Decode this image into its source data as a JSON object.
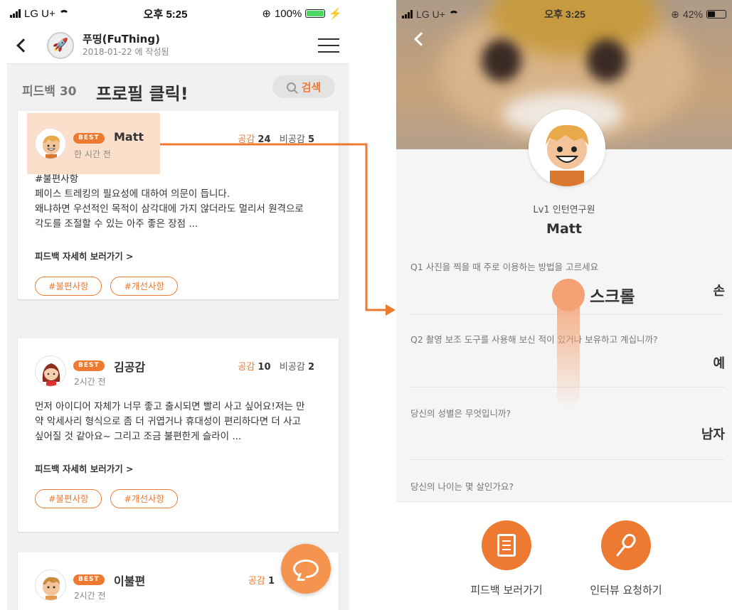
{
  "left_status": {
    "carrier": "LG U+",
    "time": "오후 5:25",
    "battery": "100%"
  },
  "right_status": {
    "carrier": "LG U+",
    "time": "오후 3:25",
    "battery": "42%"
  },
  "appbar": {
    "title": "푸띵(FuThing)",
    "subtitle": "2018-01-22 에 작성됨"
  },
  "list_header": {
    "count_label": "피드백 30",
    "annotation": "프로필 클릭!",
    "search_label": "검색"
  },
  "cards": [
    {
      "badge": "BEST",
      "name": "Matt",
      "time": "한 시간 전",
      "agree_label": "공감",
      "agree_count": "24",
      "disagree_label": "비공감",
      "disagree_count": "5",
      "lines": [
        "#불편사항",
        "페이스 트레킹의 필요성에 대하여 의문이 듭니다.",
        "왜냐하면 우선적인 목적이 삼각대에 가지 않더라도 멀리서 원격으로",
        "각도를 조절할 수 있는 아주 좋은 장점 ..."
      ],
      "detail": "피드백 자세히 보러가기 >",
      "tags": [
        "#불편사항",
        "#개선사항"
      ]
    },
    {
      "badge": "BEST",
      "name": "김공감",
      "time": "2시간 전",
      "agree_label": "공감",
      "agree_count": "10",
      "disagree_label": "비공감",
      "disagree_count": "2",
      "lines": [
        "먼저 아이디어 자체가 너무 좋고 출시되면 빨리 사고 싶어요!저는 만",
        "약 악세사리 형식으로 좀 더 귀엽거나 휴대성이 편리하다면 더 사고",
        "싶어질 것 같아요~ 그리고 조금 불편한게 슬라이 ..."
      ],
      "detail": "피드백 자세히 보러가기 >",
      "tags": [
        "#불편사항",
        "#개선사항"
      ]
    },
    {
      "badge": "BEST",
      "name": "이불편",
      "time": "2시간 전",
      "agree_label": "공감",
      "agree_count": "1"
    }
  ],
  "profile": {
    "level": "Lv1 인턴연구원",
    "name": "Matt"
  },
  "survey": [
    {
      "q": "Q1 사진을 찍을 때 주로 이용하는 방법을 고르세요",
      "a": "손"
    },
    {
      "q": "Q2 촬영 보조 도구를 사용해 보신 적이 있거나 보유하고 계십니까?",
      "a": "예"
    },
    {
      "q": "당신의 성별은 무엇입니까?",
      "a": "남자"
    },
    {
      "q": "당신의 나이는 몇 살인가요?",
      "a": ""
    }
  ],
  "scroll_annotation": "스크롤",
  "bottom_actions": {
    "feedback": "피드백 보러가기",
    "interview": "인터뷰 요청하기"
  },
  "colors": {
    "accent": "#ee7a32",
    "highlight": "#fbd9c1",
    "arrow": "#ee7a32"
  },
  "icons": [
    "back-icon",
    "rocket-logo-icon",
    "hamburger-icon",
    "search-icon",
    "chat-bubble-icon",
    "document-icon",
    "microphone-icon"
  ]
}
